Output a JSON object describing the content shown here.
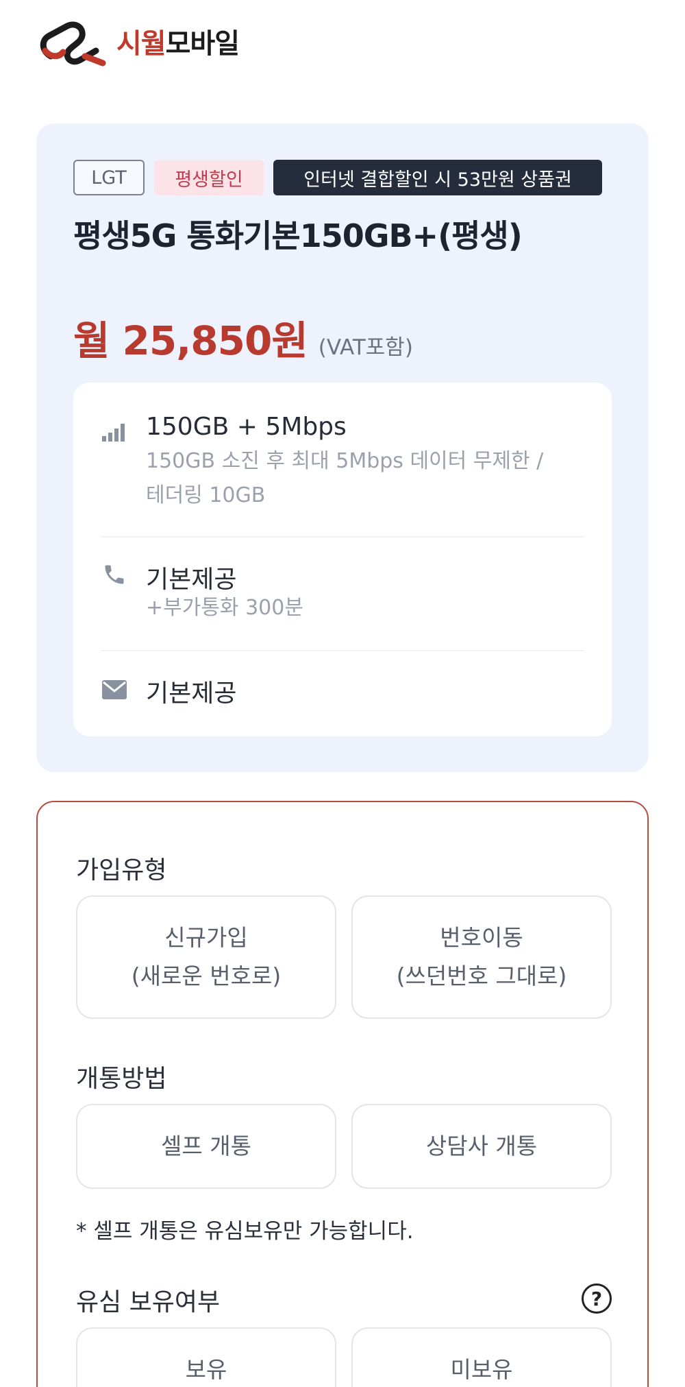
{
  "header": {
    "logo_text_red": "시월",
    "logo_text_dark": "모바일"
  },
  "plan": {
    "badges": {
      "carrier": "LGT",
      "discount": "평생할인",
      "promo": "인터넷 결합할인 시 53만원 상품권"
    },
    "title": "평생5G 통화기본150GB+(평생)",
    "price": "월 25,850원",
    "vat": "(VAT포함)",
    "specs": [
      {
        "icon": "signal-bars-icon",
        "main": "150GB + 5Mbps",
        "sub_line1": "150GB 소진 후 최대 5Mbps 데이터 무제한 /",
        "sub_line2": "테더링 10GB"
      },
      {
        "icon": "phone-icon",
        "main": "기본제공",
        "sub_line1": "+부가통화 300분"
      },
      {
        "icon": "envelope-icon",
        "main": "기본제공"
      }
    ]
  },
  "options": {
    "join_type": {
      "label": "가입유형",
      "new_line1": "신규가입",
      "new_line2": "(새로운 번호로)",
      "port_line1": "번호이동",
      "port_line2": "(쓰던번호 그대로)"
    },
    "activation": {
      "label": "개통방법",
      "self": "셀프 개통",
      "agent": "상담사 개통",
      "note": "* 셀프 개통은 유심보유만 가능합니다."
    },
    "usim": {
      "label": "유심 보유여부",
      "help": "?",
      "have": "보유",
      "not_have": "미보유"
    }
  },
  "colors": {
    "accent_red": "#b83a2f",
    "card_bg": "#eef2fc",
    "promo_bg": "#252d3d"
  }
}
